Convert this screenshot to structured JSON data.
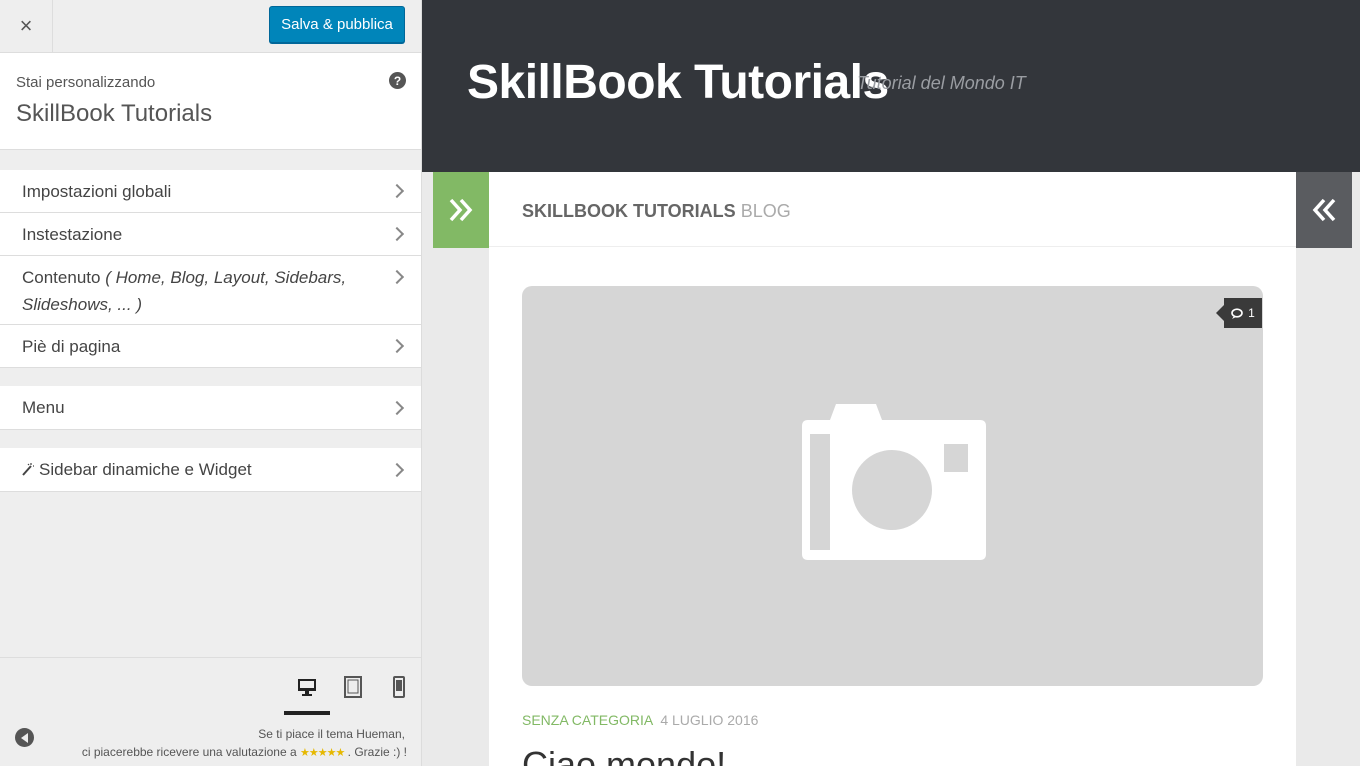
{
  "customizer": {
    "close_label": "×",
    "publish_label": "Salva & pubblica",
    "info_pre": "Stai personalizzando",
    "info_site": "SkillBook Tutorials",
    "help_label": "?",
    "panels": [
      {
        "label": "Impostazioni globali"
      },
      {
        "label": "Instestazione"
      },
      {
        "label": "Contenuto",
        "sub": "( Home, Blog, Layout, Sidebars, Slideshows, ... )"
      },
      {
        "label": "Piè di pagina"
      },
      {
        "label": "Menu"
      },
      {
        "label": "Sidebar dinamiche e Widget"
      }
    ],
    "rating": {
      "line1": "Se ti piace il tema Hueman,",
      "line2_pre": "ci piacerebbe ricevere una valutazione a",
      "stars": "★★★★★",
      "line2_post": ". Grazie :) !"
    }
  },
  "preview": {
    "site_title": "SkillBook Tutorials",
    "tagline": "Tutorial del Mondo IT",
    "heading_main": "SkillBook Tutorials",
    "heading_light": "Blog",
    "comment_count": "1",
    "post_category": "Senza categoria",
    "post_date": "4 luglio 2016",
    "post_title_partial": "Ciao mondo!"
  },
  "colors": {
    "publish": "#0085ba",
    "header_bg": "#33363b",
    "accent_green": "#82b965",
    "toggle_dark": "#5a5c60"
  },
  "icons": [
    "close-icon",
    "help-icon",
    "chevron-right-icon",
    "wand-icon",
    "desktop-icon",
    "tablet-icon",
    "mobile-icon",
    "collapse-icon",
    "double-chevron-right-icon",
    "double-chevron-left-icon",
    "camera-icon",
    "comment-icon"
  ]
}
